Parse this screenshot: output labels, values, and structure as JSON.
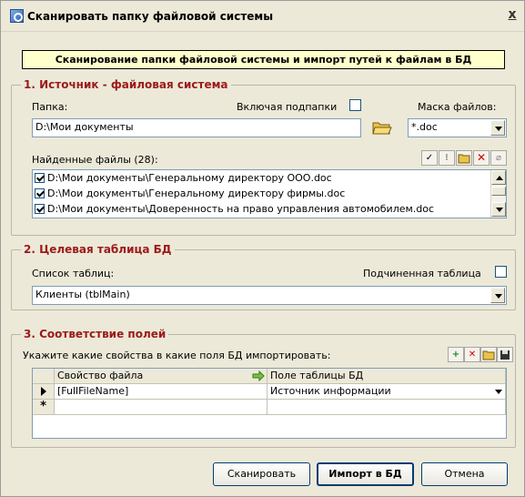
{
  "window": {
    "title": "Сканировать папку файловой системы",
    "close_label": "x"
  },
  "banner": "Сканирование папки файловой системы и импорт путей к файлам в БД",
  "source": {
    "legend": "1. Источник - файловая система",
    "folder_label": "Папка:",
    "folder_value": "D:\\Мои документы",
    "include_subfolders_label": "Включая подпапки",
    "include_subfolders_checked": false,
    "mask_label": "Маска файлов:",
    "mask_value": "*.doc",
    "found_label": "Найденные файлы (28):",
    "files": [
      {
        "path": "D:\\Мои документы\\Генеральному директору ООО.doc",
        "checked": true
      },
      {
        "path": "D:\\Мои документы\\Генеральному директору фирмы.doc",
        "checked": true
      },
      {
        "path": "D:\\Мои документы\\Доверенность на право управления автомобилем.doc",
        "checked": true
      }
    ]
  },
  "target": {
    "legend": "2. Целевая таблица БД",
    "tables_label": "Список таблиц:",
    "subordinate_label": "Подчиненная таблица",
    "subordinate_checked": false,
    "table_value": "Клиенты (tblMain)"
  },
  "mapping": {
    "legend": "3. Соответствие полей",
    "instruction": "Укажите какие свойства в какие поля БД импортировать:",
    "columns": [
      "Свойство файла",
      "Поле таблицы БД"
    ],
    "rows": [
      {
        "property": "[FullFileName]",
        "field": "Источник информации"
      }
    ],
    "new_row_marker": "*"
  },
  "buttons": {
    "scan": "Сканировать",
    "import": "Импорт в БД",
    "cancel": "Отмена"
  },
  "colors": {
    "legend": "#9b1a1a",
    "banner_bg": "#ffffcc",
    "window_bg": "#ece9d8"
  }
}
